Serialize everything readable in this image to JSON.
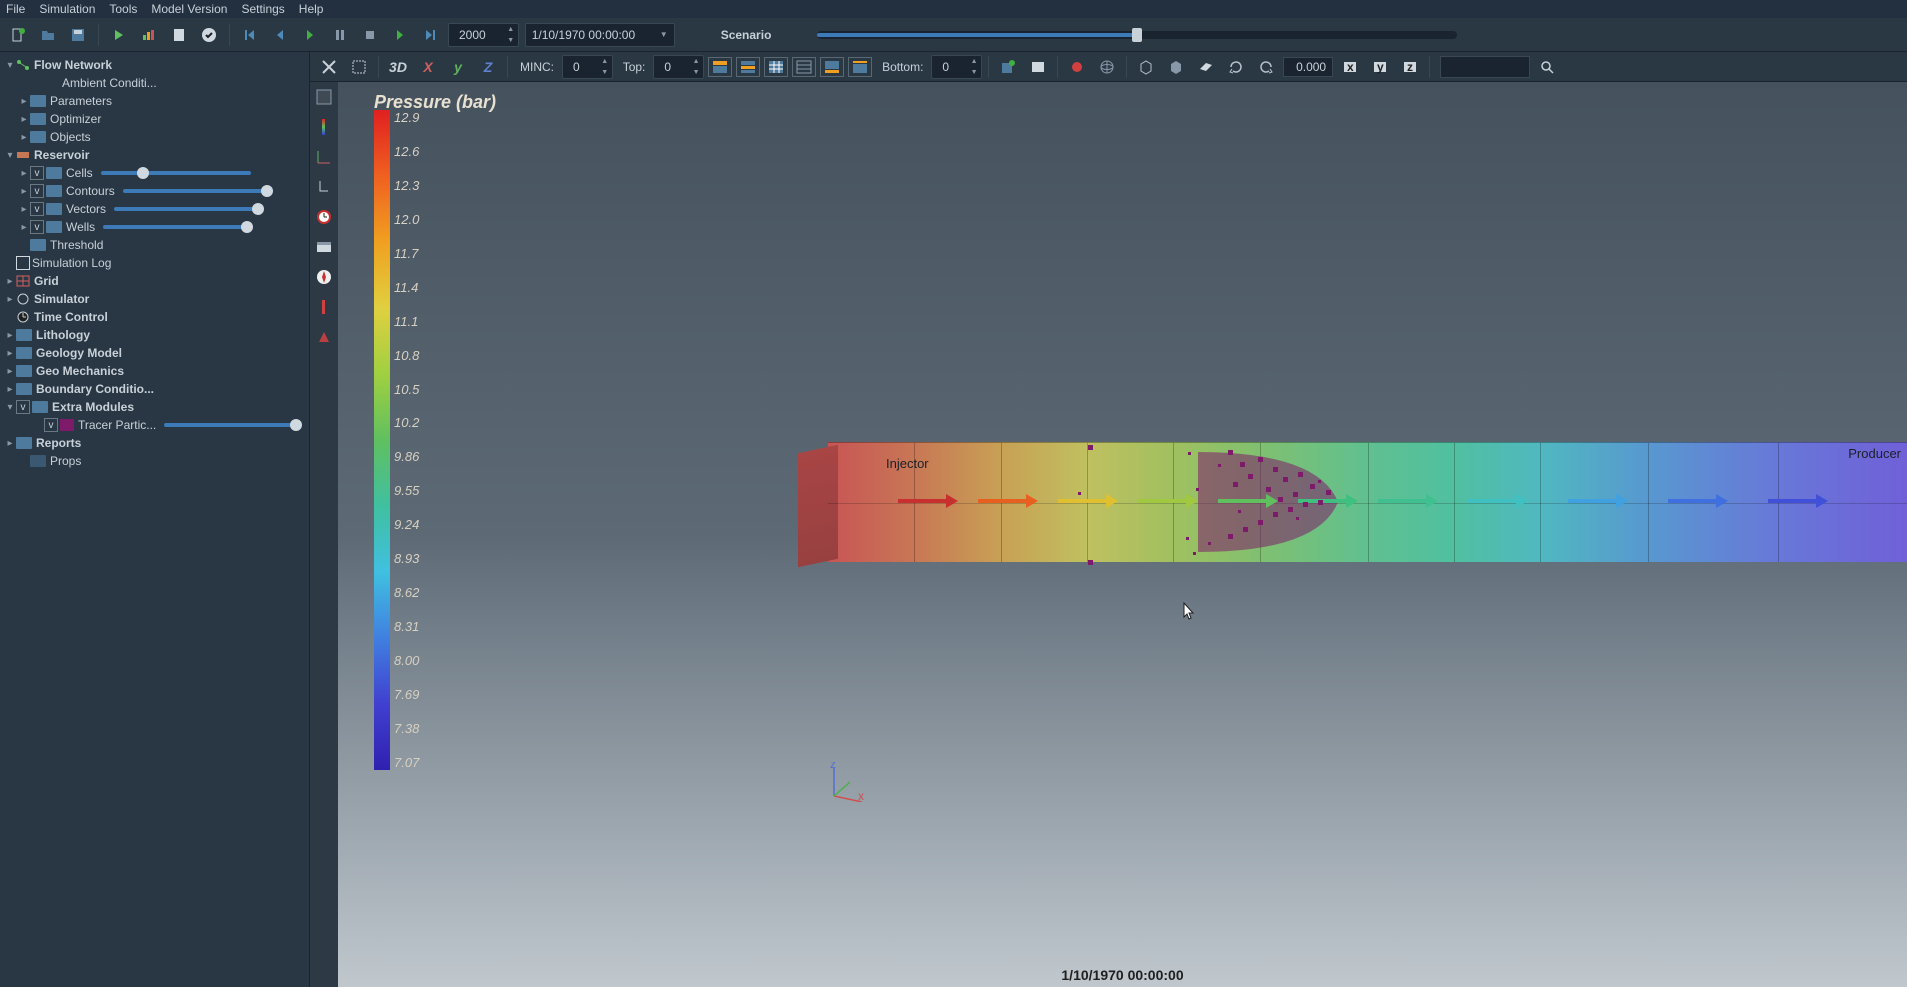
{
  "menu": {
    "file": "File",
    "simulation": "Simulation",
    "tools": "Tools",
    "model_version": "Model Version",
    "settings": "Settings",
    "help": "Help"
  },
  "toolbar": {
    "step_value": "2000",
    "datetime": "1/10/1970 00:00:00",
    "scenario_label": "Scenario"
  },
  "toolbar2": {
    "d3": "3D",
    "minc_label": "MINC:",
    "minc_value": "0",
    "top_label": "Top:",
    "top_value": "0",
    "bottom_label": "Bottom:",
    "bottom_value": "0",
    "zoom_value": "0.000"
  },
  "tree": {
    "flow_network": "Flow Network",
    "ambient": "Ambient Conditi...",
    "parameters": "Parameters",
    "optimizer": "Optimizer",
    "objects": "Objects",
    "reservoir": "Reservoir",
    "cells": "Cells",
    "contours": "Contours",
    "vectors": "Vectors",
    "wells": "Wells",
    "threshold": "Threshold",
    "simlog": "Simulation Log",
    "grid": "Grid",
    "simulator": "Simulator",
    "time_control": "Time Control",
    "lithology": "Lithology",
    "geology": "Geology Model",
    "geomech": "Geo Mechanics",
    "boundary": "Boundary Conditio...",
    "extra": "Extra Modules",
    "tracer": "Tracer Partic...",
    "reports": "Reports",
    "props": "Props"
  },
  "viewport": {
    "title": "Pressure (bar)",
    "legend": [
      "12.9",
      "12.6",
      "12.3",
      "12.0",
      "11.7",
      "11.4",
      "11.1",
      "10.8",
      "10.5",
      "10.2",
      "9.86",
      "9.55",
      "9.24",
      "8.93",
      "8.62",
      "8.31",
      "8.00",
      "7.69",
      "7.38",
      "7.07"
    ],
    "well_injector": "Injector",
    "well_producer": "Producer",
    "status_time": "1/10/1970 00:00:00"
  }
}
